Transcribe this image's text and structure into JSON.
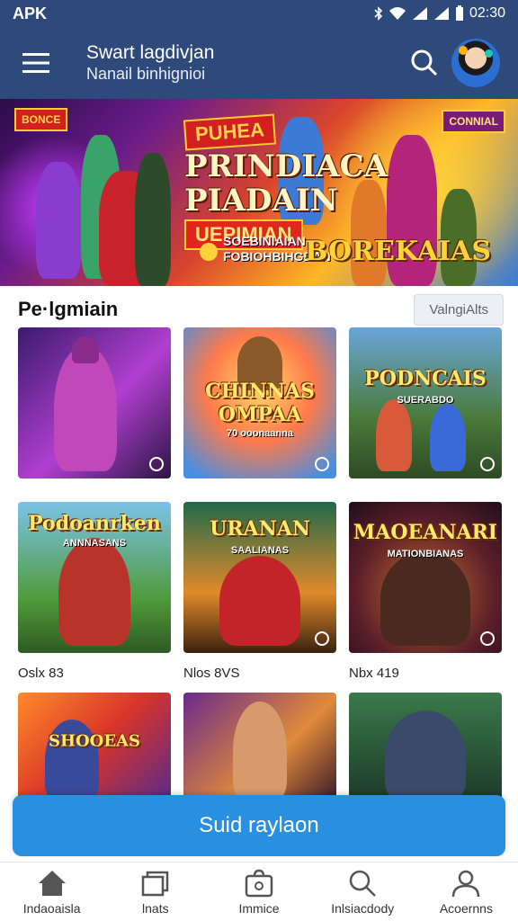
{
  "status": {
    "carrier": "APK",
    "time": "02:30"
  },
  "app_bar": {
    "title": "Swart lagdivjan",
    "subtitle": "Nanail binhignioi"
  },
  "banner": {
    "badge": "PUHEA",
    "title_line1": "PRINDIACA",
    "title_line2": "PIADAIN",
    "ribbon": "UEPIMIAN",
    "caption_line1": "SOEBINIAIAN",
    "caption_line2": "FOBIOHBIHGDAN",
    "logo_left": "BONCE",
    "logo_right": "CONNIAL",
    "brand": "BOREKAIAS"
  },
  "section": {
    "title": "Pe·lgmiain",
    "view_all": "ValngiAlts"
  },
  "games": [
    {
      "title": "",
      "sub": ""
    },
    {
      "title": "CHINNAS OMPAA",
      "sub": "70 ooonaanna"
    },
    {
      "title": "PODNCAIS",
      "sub": "SUERABDO"
    },
    {
      "title": "Podoanrken",
      "sub": "ANNNASANS",
      "label": "Oslx 83"
    },
    {
      "title": "URANAN",
      "sub": "SAALIANAS",
      "label": "Nlos 8VS"
    },
    {
      "title": "MAOEANARI",
      "sub": "MATIONBIANAS",
      "label": "Nbx 419"
    },
    {
      "title": "SHOOEAS",
      "sub": ""
    },
    {
      "title": "",
      "sub": ""
    },
    {
      "title": "",
      "sub": ""
    }
  ],
  "cta": {
    "label": "Suid raylaon"
  },
  "bottom_nav": [
    {
      "label": "Indaoaisla",
      "icon": "home-icon"
    },
    {
      "label": "lnats",
      "icon": "folder-icon"
    },
    {
      "label": "Immice",
      "icon": "bag-icon"
    },
    {
      "label": "Inlsiacdody",
      "icon": "search-icon"
    },
    {
      "label": "Acoernns",
      "icon": "user-icon"
    }
  ],
  "colors": {
    "primary": "#2d4a7a",
    "accent": "#2b8fe0"
  }
}
